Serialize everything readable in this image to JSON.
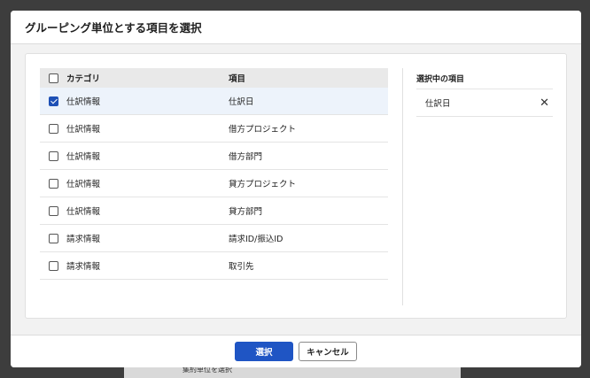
{
  "dialog": {
    "title": "グルーピング単位とする項目を選択"
  },
  "table": {
    "header": {
      "category": "カテゴリ",
      "item": "項目"
    },
    "rows": [
      {
        "category": "仕訳情報",
        "item": "仕訳日",
        "checked": true
      },
      {
        "category": "仕訳情報",
        "item": "借方プロジェクト",
        "checked": false
      },
      {
        "category": "仕訳情報",
        "item": "借方部門",
        "checked": false
      },
      {
        "category": "仕訳情報",
        "item": "貸方プロジェクト",
        "checked": false
      },
      {
        "category": "仕訳情報",
        "item": "貸方部門",
        "checked": false
      },
      {
        "category": "請求情報",
        "item": "請求ID/振込ID",
        "checked": false
      },
      {
        "category": "請求情報",
        "item": "取引先",
        "checked": false
      }
    ]
  },
  "selected_panel": {
    "title": "選択中の項目",
    "items": [
      {
        "label": "仕訳日",
        "remove_icon": "close-icon"
      }
    ]
  },
  "footer": {
    "select_label": "選択",
    "cancel_label": "キャンセル"
  },
  "background": {
    "partial_text": "集約単位を選択"
  },
  "colors": {
    "primary": "#1f55c4",
    "selected_row": "#edf3fb"
  }
}
